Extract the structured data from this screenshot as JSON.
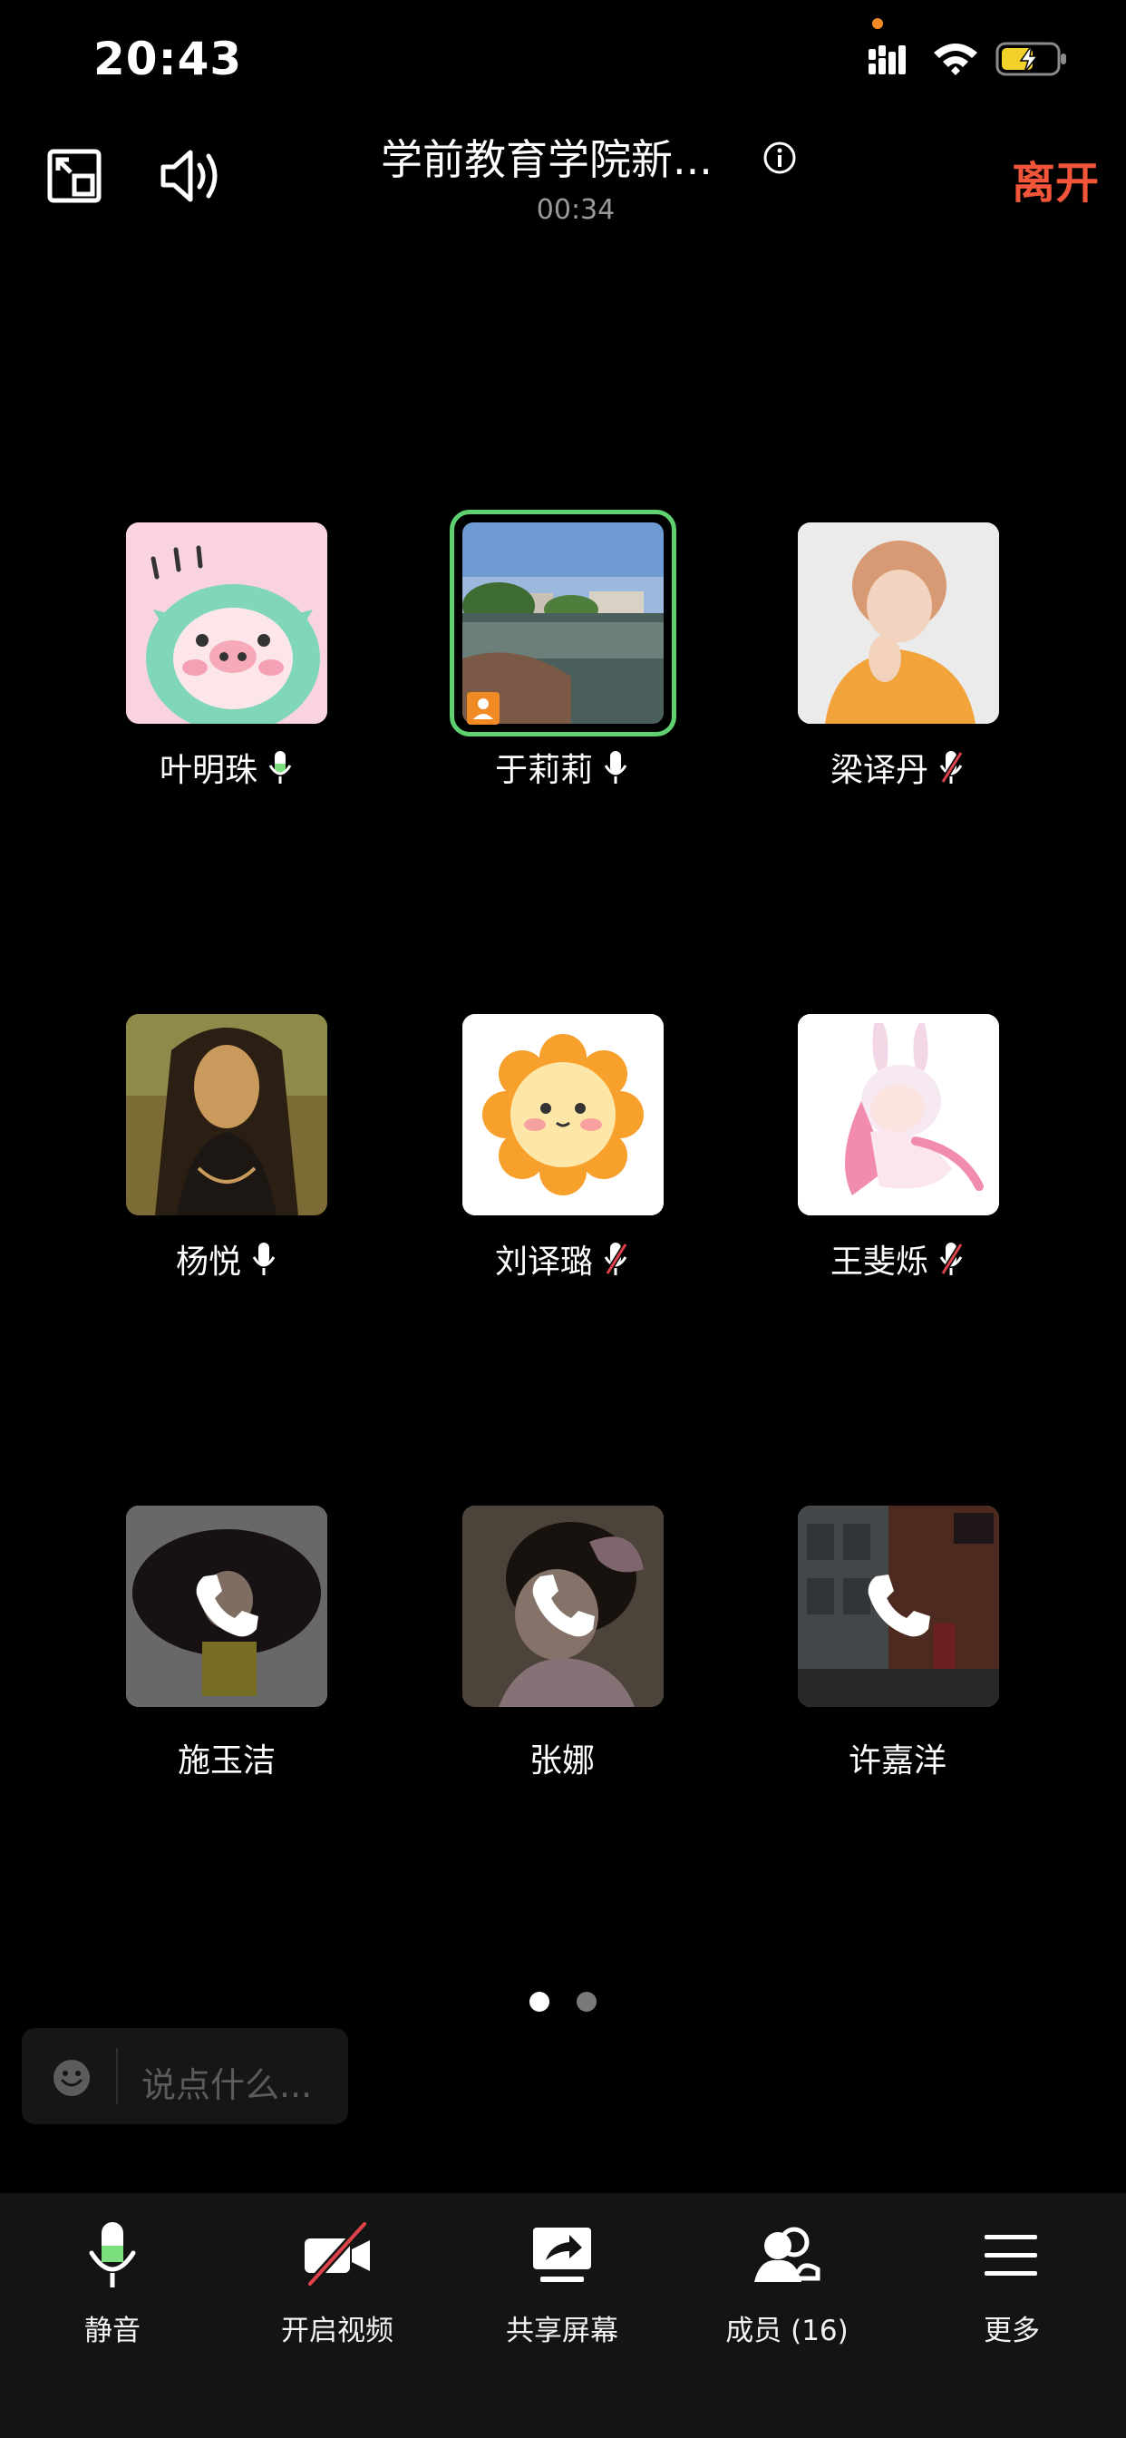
{
  "status_bar": {
    "time": "20:43"
  },
  "header": {
    "title": "学前教育学院新...",
    "duration": "00:34",
    "leave_label": "离开"
  },
  "participants": [
    {
      "name": "叶明珠",
      "mic": "on",
      "avatar": "pig-cartoon-avatar"
    },
    {
      "name": "于莉莉",
      "mic": "on",
      "avatar": "lake-photo-avatar",
      "active_speaker": true
    },
    {
      "name": "梁译丹",
      "mic": "muted",
      "avatar": "person-photo-avatar"
    },
    {
      "name": "杨悦",
      "mic": "on",
      "avatar": "portrait-painting-avatar"
    },
    {
      "name": "刘译璐",
      "mic": "muted",
      "avatar": "sun-character-avatar"
    },
    {
      "name": "王斐烁",
      "mic": "muted",
      "avatar": "anime-bunny-avatar"
    },
    {
      "name": "施玉洁",
      "mic": "calling",
      "avatar": "dark-hair-avatar"
    },
    {
      "name": "张娜",
      "mic": "calling",
      "avatar": "child-photo-avatar"
    },
    {
      "name": "许嘉洋",
      "mic": "calling",
      "avatar": "street-photo-avatar"
    }
  ],
  "pager": {
    "current": 1,
    "total": 2
  },
  "chat": {
    "placeholder": "说点什么..."
  },
  "toolbar": {
    "mute_label": "静音",
    "video_label": "开启视频",
    "share_label": "共享屏幕",
    "members_label": "成员 (16)",
    "more_label": "更多"
  },
  "colors": {
    "accent_leave": "#f2553a",
    "speaking_border": "#5fd170",
    "mic_level": "#7be07b",
    "mute_slash": "#e0424a"
  }
}
